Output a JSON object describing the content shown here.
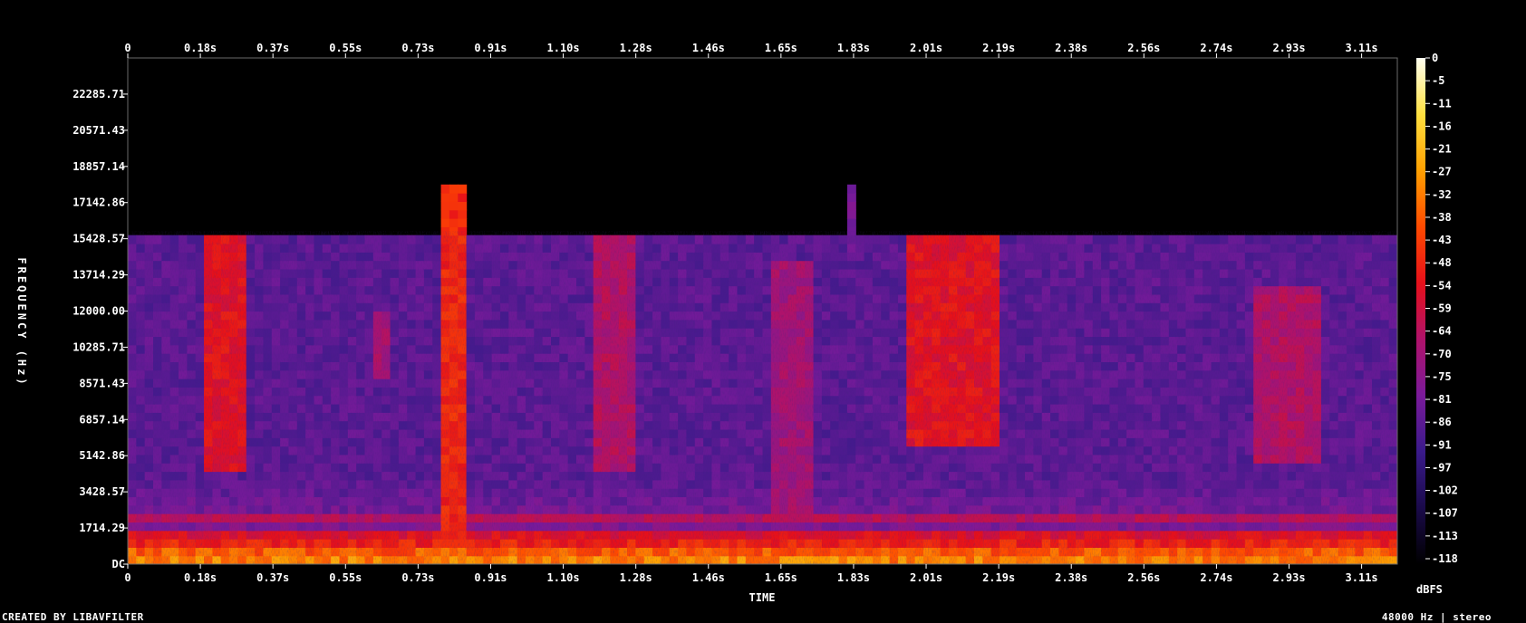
{
  "chart_data": {
    "type": "heatmap",
    "title": "",
    "xlabel": "TIME",
    "ylabel": "FREQUENCY (Hz)",
    "x_ticks": [
      "0",
      "0.18s",
      "0.37s",
      "0.55s",
      "0.73s",
      "0.91s",
      "1.10s",
      "1.28s",
      "1.46s",
      "1.65s",
      "1.83s",
      "2.01s",
      "2.19s",
      "2.38s",
      "2.56s",
      "2.74s",
      "2.93s",
      "3.11s"
    ],
    "y_ticks": [
      "DC",
      "1714.29",
      "3428.57",
      "5142.86",
      "6857.14",
      "8571.43",
      "10285.71",
      "12000.00",
      "13714.29",
      "15428.57",
      "17142.86",
      "18857.14",
      "20571.43",
      "22285.71"
    ],
    "xlim": [
      0,
      3.2
    ],
    "ylim": [
      0,
      24000
    ],
    "colorbar": {
      "label": "dBFS",
      "ticks": [
        "0",
        "-5",
        "-11",
        "-16",
        "-21",
        "-27",
        "-32",
        "-38",
        "-43",
        "-48",
        "-54",
        "-59",
        "-64",
        "-70",
        "-75",
        "-81",
        "-86",
        "-91",
        "-97",
        "-102",
        "-107",
        "-113",
        "-118"
      ],
      "range": [
        -120,
        0
      ],
      "colors": [
        "#000000",
        "#1a0a4a",
        "#3a1a8a",
        "#7a1a9a",
        "#b0126a",
        "#e6101a",
        "#ff4a00",
        "#ffa000",
        "#ffe040",
        "#fffff0"
      ]
    },
    "spectrogram": {
      "cutoff_hz": 15700,
      "base_level": 0.28,
      "bursts": [
        {
          "time_start": 0.2,
          "time_end": 0.3,
          "freq_low": 4500,
          "freq_high": 15500,
          "level": 0.55
        },
        {
          "time_start": 0.62,
          "time_end": 0.66,
          "freq_low": 9000,
          "freq_high": 12000,
          "level": 0.42
        },
        {
          "time_start": 0.78,
          "time_end": 0.86,
          "freq_low": 0,
          "freq_high": 18100,
          "level": 0.6
        },
        {
          "time_start": 1.18,
          "time_end": 1.28,
          "freq_low": 4500,
          "freq_high": 15500,
          "level": 0.45
        },
        {
          "time_start": 1.62,
          "time_end": 1.72,
          "freq_low": 2000,
          "freq_high": 14500,
          "level": 0.42
        },
        {
          "time_start": 1.81,
          "time_end": 1.84,
          "freq_low": 15000,
          "freq_high": 18000,
          "level": 0.34
        },
        {
          "time_start": 1.96,
          "time_end": 2.2,
          "freq_low": 5800,
          "freq_high": 15500,
          "level": 0.55
        },
        {
          "time_start": 2.84,
          "time_end": 3.0,
          "freq_low": 5000,
          "freq_high": 13000,
          "level": 0.45
        }
      ],
      "harmonic_bands": [
        {
          "freq_hz": 300,
          "level": 0.8
        },
        {
          "freq_hz": 600,
          "level": 0.74
        },
        {
          "freq_hz": 1000,
          "level": 0.64
        },
        {
          "freq_hz": 1400,
          "level": 0.58
        },
        {
          "freq_hz": 2100,
          "level": 0.5
        }
      ]
    }
  },
  "footer": {
    "left": "CREATED BY LIBAVFILTER",
    "right": "48000 Hz | stereo"
  }
}
